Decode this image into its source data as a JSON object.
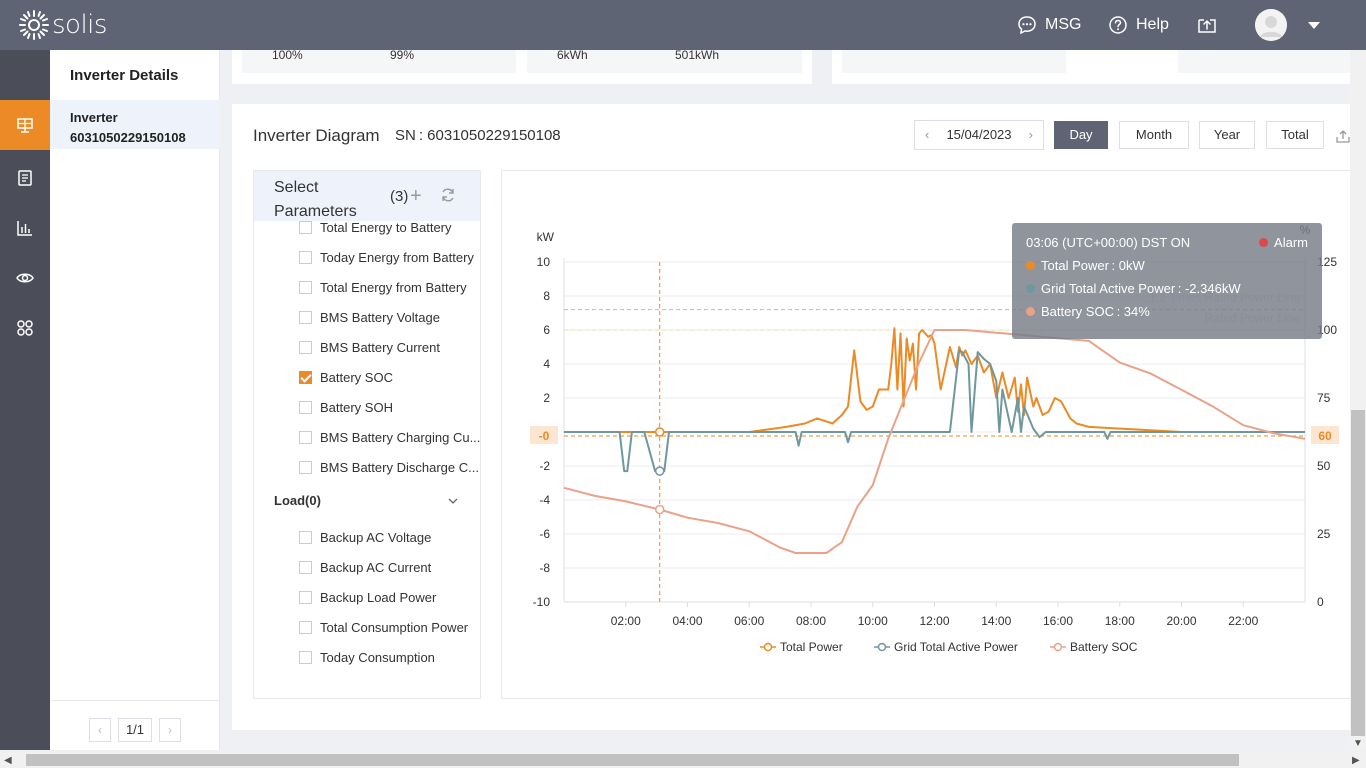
{
  "app": {
    "logo_text": "solis"
  },
  "topbar": {
    "msg_label": "MSG",
    "help_label": "Help"
  },
  "sidebar": {
    "title": "Inverter Details",
    "selected_line1": "Inverter",
    "selected_line2": "6031050229150108",
    "pager": {
      "prev": "‹",
      "page": "1/1",
      "next": "›"
    }
  },
  "summary": {
    "values": [
      "100%",
      "99%",
      "6kWh",
      "501kWh"
    ]
  },
  "panel": {
    "title": "Inverter Diagram",
    "sn": "SN :  6031050229150108",
    "date": "15/04/2023",
    "prev_arrow": "‹",
    "next_arrow": "›",
    "range_buttons": [
      "Day",
      "Month",
      "Year",
      "Total"
    ],
    "active_range": "Day"
  },
  "params": {
    "title": "Select Parameters",
    "count": "(3)",
    "battery_items": [
      {
        "label": "Today Energy to Battery",
        "checked": false
      },
      {
        "label": "Total Energy to Battery",
        "checked": false
      },
      {
        "label": "Today Energy from Battery",
        "checked": false
      },
      {
        "label": "Total Energy from Battery",
        "checked": false
      },
      {
        "label": "BMS Battery Voltage",
        "checked": false
      },
      {
        "label": "BMS Battery Current",
        "checked": false
      },
      {
        "label": "Battery SOC",
        "checked": true
      },
      {
        "label": "Battery SOH",
        "checked": false
      },
      {
        "label": "BMS Battery Charging Cu...",
        "checked": false
      },
      {
        "label": "BMS Battery Discharge C...",
        "checked": false
      }
    ],
    "load_group": "Load(0)",
    "load_items": [
      {
        "label": "Backup AC Voltage",
        "checked": false
      },
      {
        "label": "Backup AC Current",
        "checked": false
      },
      {
        "label": "Backup Load Power",
        "checked": false
      },
      {
        "label": "Total Consumption Power",
        "checked": false
      },
      {
        "label": "Today Consumption",
        "checked": false
      }
    ]
  },
  "tooltip": {
    "time": "03:06 (UTC+00:00) DST ON",
    "alarm": "Alarm",
    "rows": [
      {
        "label": "Total Power :  0kW",
        "color": "#ec8a25"
      },
      {
        "label": "Grid Total Active Power :  -2.346kW",
        "color": "#6f979e"
      },
      {
        "label": "Battery SOC :  34%",
        "color": "#e9a289"
      }
    ]
  },
  "chart_data": {
    "type": "line",
    "ylabel_left": "kW",
    "ylabel_right": "%",
    "ylim_left": [
      -10,
      10
    ],
    "yticks_left": [
      "10",
      "8",
      "6",
      "4",
      "2",
      "-0",
      "-2",
      "-4",
      "-6",
      "-8",
      "-10"
    ],
    "ylim_right": [
      0,
      125
    ],
    "yticks_right": [
      "125",
      "100",
      "75",
      "50",
      "25",
      "0"
    ],
    "xlim": [
      0,
      24
    ],
    "xticks": [
      "02:00",
      "04:00",
      "06:00",
      "08:00",
      "10:00",
      "12:00",
      "14:00",
      "16:00",
      "18:00",
      "20:00",
      "22:00"
    ],
    "marker_left_label": "-0",
    "marker_right_label": "60",
    "reference_lines": [
      {
        "name": "1.2 Times Rated Power Line",
        "value": 7.2
      },
      {
        "name": "Rated Power Line",
        "value": 6
      }
    ],
    "cursor_x": 3.1,
    "legend": [
      "Total Power",
      "Grid Total Active Power",
      "Battery SOC"
    ],
    "series": [
      {
        "name": "Total Power",
        "axis": "left",
        "color": "#ec8a25",
        "x": [
          0,
          3,
          6,
          7.2,
          7.8,
          8.2,
          8.7,
          9.0,
          9.2,
          9.4,
          9.6,
          9.8,
          10.0,
          10.2,
          10.5,
          10.6,
          10.7,
          10.8,
          10.9,
          11.0,
          11.1,
          11.2,
          11.3,
          11.4,
          11.5,
          11.6,
          11.8,
          11.9,
          12.0,
          12.2,
          12.5,
          12.7,
          12.8,
          12.9,
          13.0,
          13.2,
          13.4,
          13.6,
          13.8,
          14.0,
          14.2,
          14.4,
          14.6,
          14.7,
          14.8,
          14.9,
          15.0,
          15.2,
          15.3,
          15.5,
          15.7,
          15.9,
          16.1,
          16.4,
          16.6,
          17.0,
          18.0,
          19.0,
          20.0,
          24.0
        ],
        "y": [
          0,
          0,
          0,
          0.3,
          0.5,
          0.8,
          0.5,
          1.0,
          1.5,
          4.8,
          1.8,
          1.3,
          1.5,
          2.5,
          2.5,
          4.0,
          6.1,
          2.5,
          5.8,
          1.5,
          5.5,
          4.2,
          5.2,
          2.5,
          5.8,
          6.0,
          5.6,
          5.7,
          5.2,
          2.5,
          5.0,
          3.8,
          5.0,
          4.5,
          4.8,
          4.0,
          4.5,
          3.5,
          4.0,
          2.0,
          3.5,
          2.0,
          3.2,
          1.2,
          2.8,
          1.0,
          3.2,
          1.5,
          2.0,
          1.0,
          1.2,
          2.0,
          1.8,
          0.8,
          0.5,
          0.3,
          0.2,
          0.1,
          0,
          0
        ]
      },
      {
        "name": "Grid Total Active Power",
        "axis": "left",
        "color": "#6f979e",
        "x": [
          0,
          1.8,
          1.95,
          2.05,
          2.2,
          2.6,
          2.95,
          3.1,
          3.25,
          3.4,
          7.5,
          7.6,
          7.7,
          9.1,
          9.2,
          9.3,
          12.5,
          12.8,
          12.9,
          13.1,
          13.2,
          13.4,
          13.6,
          13.8,
          14.0,
          14.1,
          14.2,
          14.5,
          14.7,
          14.8,
          14.9,
          15.2,
          15.4,
          15.6,
          17.5,
          17.6,
          17.7,
          24.0
        ],
        "y": [
          0,
          0,
          -2.3,
          -2.3,
          0,
          0,
          -2.3,
          -2.3,
          -2.3,
          0,
          0,
          -0.8,
          0,
          0,
          -0.6,
          0,
          0,
          4.8,
          4.7,
          4.0,
          0,
          4.7,
          4.3,
          4.0,
          3.0,
          0,
          2.5,
          0,
          2.0,
          0,
          1.5,
          0.2,
          -0.3,
          0,
          0,
          -0.4,
          0,
          0
        ]
      },
      {
        "name": "Battery SOC",
        "axis": "right",
        "color": "#e9a289",
        "x": [
          0,
          1,
          2,
          3.1,
          4,
          5,
          6,
          6.5,
          7,
          7.5,
          8,
          8.5,
          9,
          9.5,
          10,
          10.5,
          11,
          11.5,
          12,
          13,
          14,
          15,
          16,
          17,
          18,
          19,
          20,
          21,
          22,
          23,
          24
        ],
        "y": [
          42,
          39,
          37,
          34,
          31,
          29,
          26,
          23,
          20,
          18,
          18,
          18,
          22,
          35,
          43,
          60,
          74,
          88,
          100,
          100,
          99,
          98,
          97,
          96,
          88,
          84,
          78,
          72,
          65,
          62,
          60
        ]
      }
    ]
  }
}
